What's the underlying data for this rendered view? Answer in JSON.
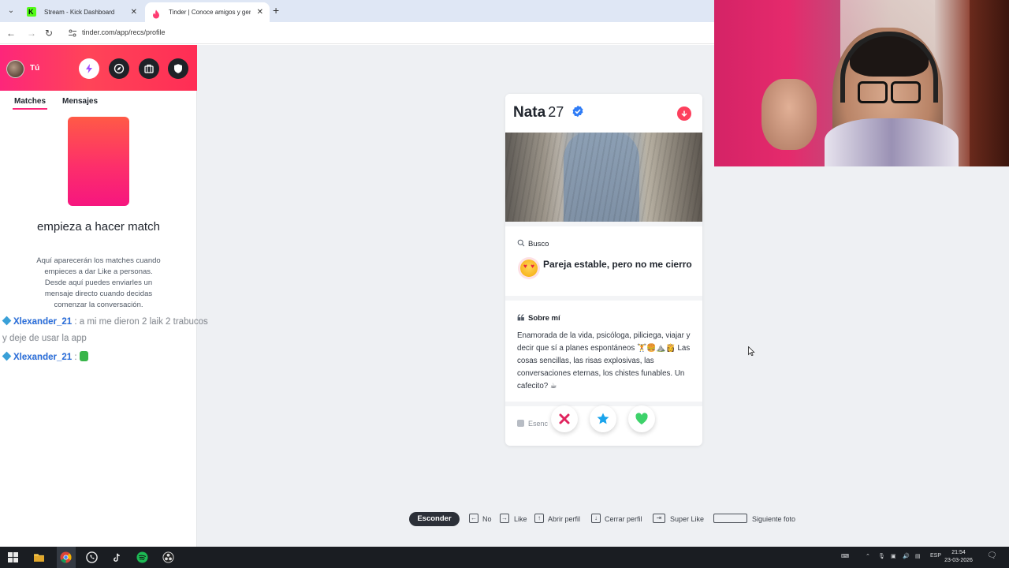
{
  "browser": {
    "tabs": [
      {
        "title": "Stream - Kick Dashboard",
        "active": false
      },
      {
        "title": "Tinder | Conoce amigos y gente",
        "active": true
      }
    ],
    "url": "tinder.com/app/recs/profile"
  },
  "sidebar": {
    "user_label": "Tú",
    "tabs": [
      "Matches",
      "Mensajes"
    ],
    "empty_title": "empieza a hacer match",
    "empty_description": "Aquí aparecerán los matches cuando empieces a dar Like a personas. Desde aquí puedes enviarles un mensaje directo cuando decidas comenzar la conversación."
  },
  "chat_overlay": [
    {
      "user": "Xlexander_21",
      "text": ": a mi me dieron 2 laik 2 trabucos y deje de usar la app"
    },
    {
      "user": "Xlexander_21",
      "text": ":"
    }
  ],
  "profile": {
    "name": "Nata",
    "age": "27",
    "looking_label": "Busco",
    "looking_value": "Pareja estable, pero no me cierro",
    "about_label": "Sobre mí",
    "about_text": "Enamorada de la vida, psicóloga, piliciega, viajar y decir que sí a planes espontáneos 🏋️🍔⛰️👸 Las cosas sencillas, las risas explosivas, las conversaciones eternas, los chistes funables. Un cafecito? ☕",
    "essentials_label": "Esenc"
  },
  "shortcuts": {
    "hide": "Esconder",
    "items": [
      {
        "key": "←",
        "label": "No"
      },
      {
        "key": "→",
        "label": "Like"
      },
      {
        "key": "↑",
        "label": "Abrir perfil"
      },
      {
        "key": "↓",
        "label": "Cerrar perfil"
      },
      {
        "key": "⇥",
        "label": "Super Like"
      },
      {
        "key": "",
        "label": "Siguiente foto"
      }
    ]
  },
  "taskbar": {
    "lang": "ESP",
    "time": "21:54",
    "date": "23-03-2026"
  },
  "colors": {
    "brand_gradient_start": "#fd267a",
    "brand_gradient_end": "#ff7854",
    "nope": "#e0245e",
    "superlike": "#1aa4ec",
    "like": "#3dd26a",
    "verified": "#2f7cf6"
  }
}
